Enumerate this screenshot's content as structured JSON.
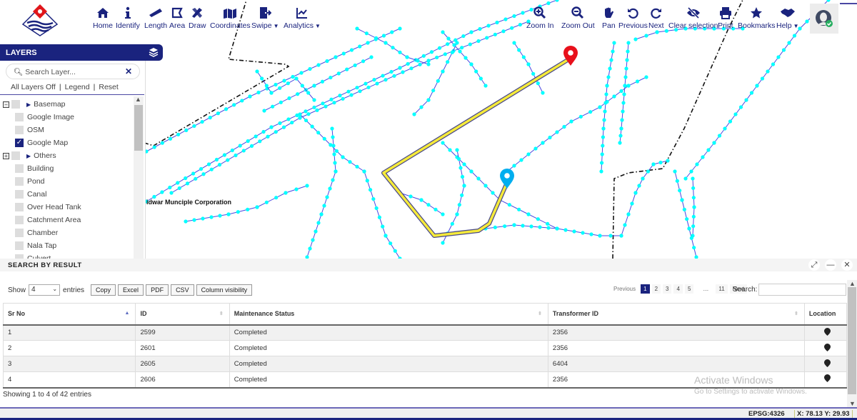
{
  "toolbar": {
    "left_tools": [
      {
        "label": "Home",
        "icon": "home-icon"
      },
      {
        "label": "Identify",
        "icon": "info-icon"
      },
      {
        "label": "Length",
        "icon": "ruler-icon"
      },
      {
        "label": "Area",
        "icon": "area-icon"
      },
      {
        "label": "Draw",
        "icon": "draw-icon"
      },
      {
        "label": "Coordinates",
        "icon": "map-marker-icon"
      },
      {
        "label": "Swipe",
        "icon": "swipe-icon",
        "dropdown": true
      },
      {
        "label": "Analytics",
        "icon": "chart-icon",
        "dropdown": true
      }
    ],
    "right_tools": [
      {
        "label": "Zoom In",
        "icon": "zoom-in-icon"
      },
      {
        "label": "Zoom Out",
        "icon": "zoom-out-icon"
      },
      {
        "label": "Pan",
        "icon": "hand-icon"
      },
      {
        "label": "Previous",
        "icon": "undo-icon"
      },
      {
        "label": "Next",
        "icon": "redo-icon"
      },
      {
        "label": "Clear selection",
        "icon": "eye-slash-icon"
      },
      {
        "label": "Print",
        "icon": "print-icon"
      },
      {
        "label": "Bookmarks",
        "icon": "star-icon"
      },
      {
        "label": "Help",
        "icon": "handshake-icon",
        "dropdown": true
      }
    ]
  },
  "layers": {
    "title": "LAYERS",
    "search_placeholder": "Search Layer...",
    "actions": [
      "All Layers Off",
      "Legend",
      "Reset"
    ],
    "groups": [
      {
        "label": "Basemap",
        "expanded": true,
        "items": [
          {
            "label": "Google Image",
            "checked": false
          },
          {
            "label": "OSM",
            "checked": false
          },
          {
            "label": "Google Map",
            "checked": true
          }
        ]
      },
      {
        "label": "Others",
        "expanded": false,
        "items": [
          {
            "label": "Building",
            "checked": false
          },
          {
            "label": "Pond",
            "checked": false
          },
          {
            "label": "Canal",
            "checked": false
          },
          {
            "label": "Over Head Tank",
            "checked": false
          },
          {
            "label": "Catchment Area",
            "checked": false
          },
          {
            "label": "Chamber",
            "checked": false
          },
          {
            "label": "Nala Tap",
            "checked": false
          },
          {
            "label": "Culvert",
            "checked": false
          }
        ]
      }
    ]
  },
  "map": {
    "label": "idwar Munciple Corporation",
    "route_color": "#f5ea3a",
    "network_color": "#00ffff",
    "line_color": "#4a47e0",
    "start_marker_color": "#e8101b",
    "end_marker_color": "#00aeef"
  },
  "results": {
    "title": "SEARCH BY RESULT",
    "show_label": "Show",
    "entries_label": "entries",
    "page_length": "4",
    "buttons": [
      "Copy",
      "Excel",
      "PDF",
      "CSV",
      "Column visibility"
    ],
    "pagination": {
      "previous": "Previous",
      "pages": [
        "1",
        "2",
        "3",
        "4",
        "5",
        "…",
        "11"
      ],
      "active": "1",
      "next": "Next"
    },
    "search_label": "Search:",
    "search_value": "",
    "columns": [
      "Sr No",
      "ID",
      "Maintenance Status",
      "Transformer ID",
      "Location"
    ],
    "rows": [
      {
        "sr": "1",
        "id": "2599",
        "status": "Completed",
        "transformer": "2356"
      },
      {
        "sr": "2",
        "id": "2601",
        "status": "Completed",
        "transformer": "2356"
      },
      {
        "sr": "3",
        "id": "2605",
        "status": "Completed",
        "transformer": "6404"
      },
      {
        "sr": "4",
        "id": "2606",
        "status": "Completed",
        "transformer": "2356"
      }
    ],
    "info": "Showing 1 to 4 of 42 entries"
  },
  "watermark": {
    "line1": "Activate Windows",
    "line2": "Go to Settings to activate Windows."
  },
  "status": {
    "epsg": "EPSG:4326",
    "coords": "X: 78.13  Y: 29.93"
  },
  "colors": {
    "brand": "#1a237e"
  }
}
